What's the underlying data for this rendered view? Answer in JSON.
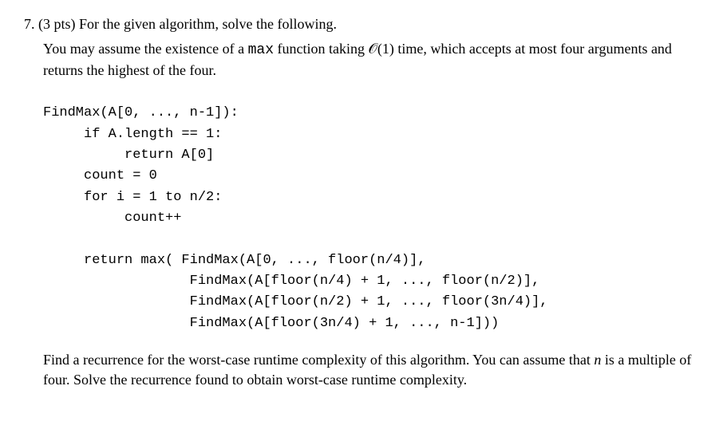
{
  "problem": {
    "number": "7.",
    "points": "(3 pts)",
    "title": "For the given algorithm, solve the following.",
    "intro_part1": "You may assume the existence of a ",
    "intro_code1": "max",
    "intro_part2": " function taking ",
    "intro_bigO": "𝒪(1)",
    "intro_part3": " time, which accepts at most four arguments and returns the highest of the four.",
    "code_line1": "FindMax(A[0, ..., n-1]):",
    "code_line2": "     if A.length == 1:",
    "code_line3": "          return A[0]",
    "code_line4": "     count = 0",
    "code_line5": "     for i = 1 to n/2:",
    "code_line6": "          count++",
    "code_line7": "",
    "code_line8": "     return max( FindMax(A[0, ..., floor(n/4)],",
    "code_line9": "                  FindMax(A[floor(n/4) + 1, ..., floor(n/2)],",
    "code_line10": "                  FindMax(A[floor(n/2) + 1, ..., floor(3n/4)],",
    "code_line11": "                  FindMax(A[floor(3n/4) + 1, ..., n-1]))",
    "task_part1": "Find a recurrence for the worst-case runtime complexity of this algorithm. You can assume that ",
    "task_var": "n",
    "task_part2": " is a multiple of four. Solve the recurrence found to obtain worst-case runtime complexity."
  }
}
